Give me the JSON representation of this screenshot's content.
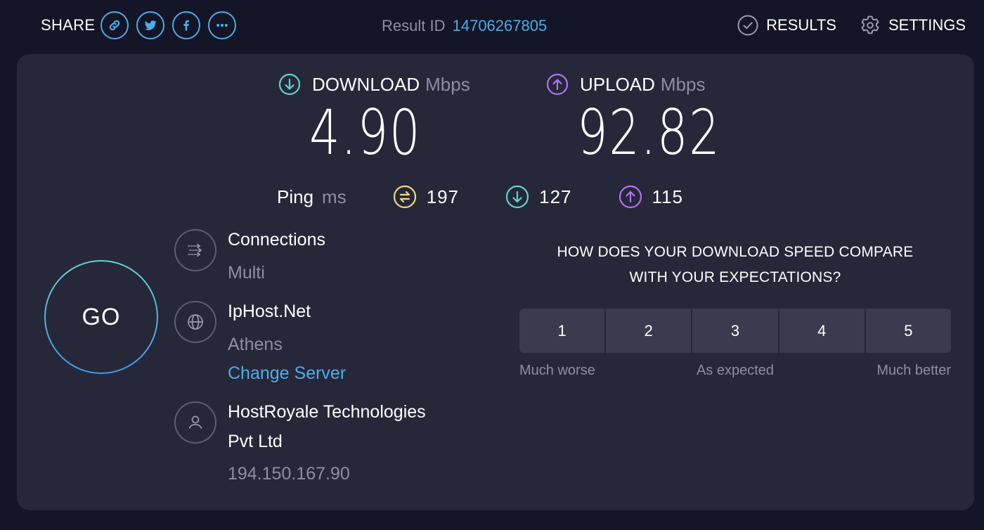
{
  "topbar": {
    "share_label": "SHARE",
    "share_buttons": [
      {
        "icon": "link-icon"
      },
      {
        "icon": "twitter-icon"
      },
      {
        "icon": "facebook-icon"
      },
      {
        "icon": "more-icon"
      }
    ],
    "result_id_label": "Result ID",
    "result_id": "14706267805",
    "nav": {
      "results": "RESULTS",
      "settings": "SETTINGS"
    }
  },
  "speeds": {
    "download": {
      "label": "DOWNLOAD",
      "unit": "Mbps",
      "value": "4.90",
      "color": "#5ed6d0"
    },
    "upload": {
      "label": "UPLOAD",
      "unit": "Mbps",
      "value": "92.82",
      "color": "#b072f0"
    }
  },
  "ping": {
    "label": "Ping",
    "unit": "ms",
    "idle": {
      "value": "197",
      "icon": "ping-idle-icon",
      "color": "#f1d97a"
    },
    "download": {
      "value": "127",
      "icon": "download-icon",
      "color": "#5ed6d0"
    },
    "upload": {
      "value": "115",
      "icon": "upload-icon",
      "color": "#b072f0"
    }
  },
  "go_label": "GO",
  "connections": {
    "title": "Connections",
    "value": "Multi"
  },
  "server": {
    "title": "IpHost.Net",
    "location": "Athens",
    "change_label": "Change Server"
  },
  "isp": {
    "name_line1": "HostRoyale Technologies",
    "name_line2": "Pvt Ltd",
    "ip": "194.150.167.90"
  },
  "survey": {
    "question_line1": "HOW DOES YOUR DOWNLOAD SPEED COMPARE",
    "question_line2": "WITH YOUR EXPECTATIONS?",
    "options": [
      "1",
      "2",
      "3",
      "4",
      "5"
    ],
    "label_low": "Much worse",
    "label_mid": "As expected",
    "label_high": "Much better"
  },
  "colors": {
    "accent_blue": "#4aaee8",
    "background": "#141526",
    "card": "#262739"
  }
}
